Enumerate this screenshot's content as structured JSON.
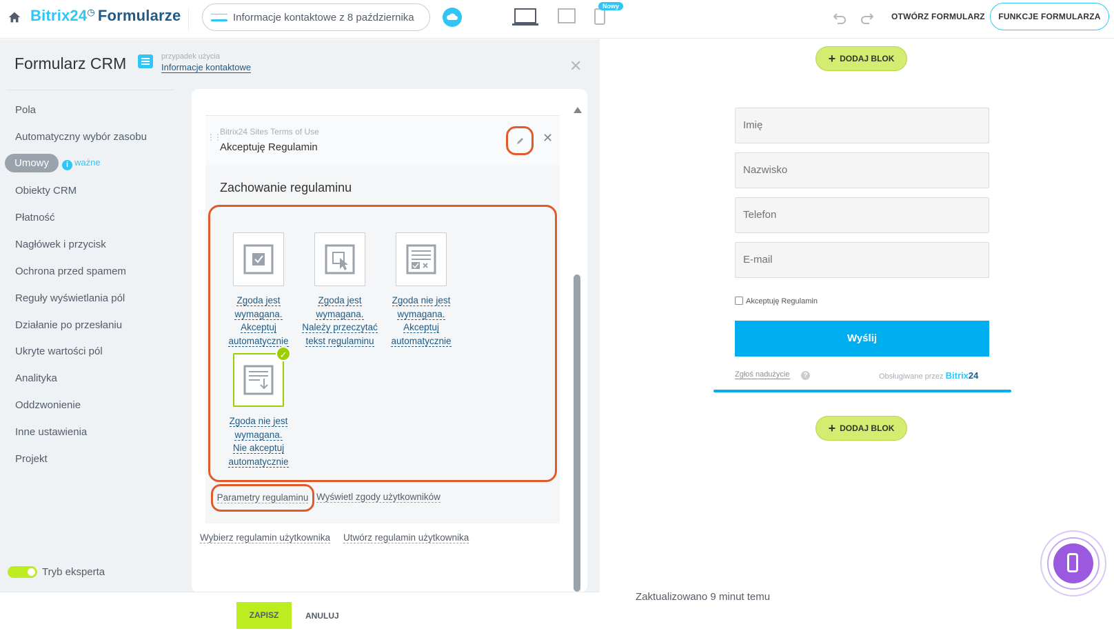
{
  "header": {
    "logo_brand": "Bitrix24",
    "logo_product": "Formularze",
    "form_name": "Informacje kontaktowe z 8 października",
    "new_badge": "Nowy",
    "open_form": "OTWÓRZ FORMULARZ",
    "form_functions": "FUNKCJE FORMULARZA"
  },
  "sidebar": {
    "title": "Formularz CRM",
    "use_case_label": "przypadek użycia",
    "use_case_value": "Informacje kontaktowe",
    "items": [
      {
        "label": "Pola"
      },
      {
        "label": "Automatyczny wybór zasobu"
      },
      {
        "label": "Umowy",
        "active": true
      },
      {
        "label": "Obiekty CRM"
      },
      {
        "label": "Płatność"
      },
      {
        "label": "Nagłówek i przycisk"
      },
      {
        "label": "Ochrona przed spamem"
      },
      {
        "label": "Reguły wyświetlania pól"
      },
      {
        "label": "Działanie po przesłaniu"
      },
      {
        "label": "Ukryte wartości pól"
      },
      {
        "label": "Analityka"
      },
      {
        "label": "Oddzwonienie"
      },
      {
        "label": "Inne ustawienia"
      },
      {
        "label": "Projekt"
      }
    ],
    "important_label": "ważne",
    "expert_mode": "Tryb eksperta"
  },
  "agreement": {
    "source": "Bitrix24 Sites Terms of Use",
    "name": "Akceptuję Regulamin",
    "behavior_title": "Zachowanie regulaminu",
    "options": [
      {
        "lines": [
          "Zgoda jest",
          "wymagana.",
          "Akceptuj",
          "automatycznie"
        ]
      },
      {
        "lines": [
          "Zgoda jest",
          "wymagana.",
          "Należy przeczytać",
          "tekst regulaminu"
        ]
      },
      {
        "lines": [
          "Zgoda nie jest",
          "wymagana.",
          "Akceptuj",
          "automatycznie"
        ]
      },
      {
        "lines": [
          "Zgoda nie jest",
          "wymagana.",
          "Nie akceptuj",
          "automatycznie"
        ],
        "selected": true
      }
    ],
    "params_link": "Parametry regulaminu",
    "consents_link": "Wyświetl zgody użytkowników",
    "choose_link": "Wybierz regulamin użytkownika",
    "create_link": "Utwórz regulamin użytkownika"
  },
  "footer": {
    "save": "ZAPISZ",
    "cancel": "ANULUJ"
  },
  "preview": {
    "add_block": "DODAJ BLOK",
    "fields": [
      "Imię",
      "Nazwisko",
      "Telefon",
      "E-mail"
    ],
    "consent_label": "Akceptuję Regulamin",
    "submit": "Wyślij",
    "report_abuse": "Zgłoś nadużycie",
    "powered_by": "Obsługiwane przez",
    "powered_brand": "Bitrix",
    "powered_num": "24",
    "updated": "Zaktualizowano 9 minut temu"
  },
  "colors": {
    "accent": "#2fc6f6",
    "highlight": "#e05a2b",
    "save_green": "#bbed21",
    "submit_blue": "#00aeef",
    "selected_green": "#9dcf00"
  }
}
